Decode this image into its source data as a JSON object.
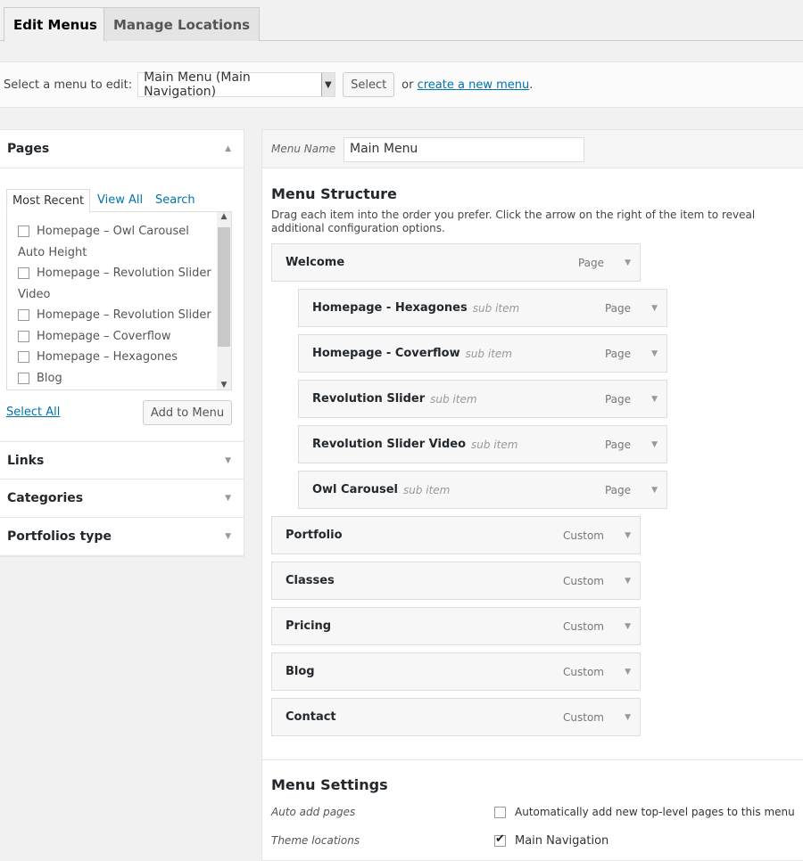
{
  "tabs": [
    {
      "label": "Edit Menus",
      "active": true
    },
    {
      "label": "Manage Locations",
      "active": false
    }
  ],
  "select_bar": {
    "label": "Select a menu to edit:",
    "value": "Main Menu (Main Navigation)",
    "button": "Select",
    "or_text": "or",
    "create_link": "create a new menu",
    "period": "."
  },
  "left": {
    "pages_title": "Pages",
    "tabs": [
      "Most Recent",
      "View All",
      "Search"
    ],
    "items": [
      {
        "label": "Homepage – Owl Carousel",
        "checkbox": true
      },
      {
        "label": "Auto Height",
        "checkbox": false
      },
      {
        "label": "Homepage – Revolution Slider",
        "checkbox": true
      },
      {
        "label": "Video",
        "checkbox": false
      },
      {
        "label": "Homepage – Revolution Slider",
        "checkbox": true
      },
      {
        "label": "Homepage – Coverflow",
        "checkbox": true
      },
      {
        "label": "Homepage – Hexagones",
        "checkbox": true
      },
      {
        "label": "Blog",
        "checkbox": true
      }
    ],
    "select_all": "Select All",
    "add_button": "Add to Menu",
    "sections": [
      "Links",
      "Categories",
      "Portfolios type"
    ]
  },
  "menu": {
    "name_label": "Menu Name",
    "name_value": "Main Menu",
    "structure_title": "Menu Structure",
    "structure_desc": "Drag each item into the order you prefer. Click the arrow on the right of the item to reveal additional configuration options.",
    "items": [
      {
        "title": "Welcome",
        "type": "Page",
        "depth": 0,
        "sub": ""
      },
      {
        "title": "Homepage - Hexagones",
        "type": "Page",
        "depth": 1,
        "sub": "sub item"
      },
      {
        "title": "Homepage - Coverflow",
        "type": "Page",
        "depth": 1,
        "sub": "sub item"
      },
      {
        "title": "Revolution Slider",
        "type": "Page",
        "depth": 1,
        "sub": "sub item"
      },
      {
        "title": "Revolution Slider Video",
        "type": "Page",
        "depth": 1,
        "sub": "sub item"
      },
      {
        "title": "Owl Carousel",
        "type": "Page",
        "depth": 1,
        "sub": "sub item"
      },
      {
        "title": "Portfolio",
        "type": "Custom",
        "depth": 0,
        "sub": ""
      },
      {
        "title": "Classes",
        "type": "Custom",
        "depth": 0,
        "sub": ""
      },
      {
        "title": "Pricing",
        "type": "Custom",
        "depth": 0,
        "sub": ""
      },
      {
        "title": "Blog",
        "type": "Custom",
        "depth": 0,
        "sub": ""
      },
      {
        "title": "Contact",
        "type": "Custom",
        "depth": 0,
        "sub": ""
      }
    ],
    "settings_title": "Menu Settings",
    "auto_add_label": "Auto add pages",
    "auto_add_text": "Automatically add new top-level pages to this menu",
    "auto_add_checked": false,
    "theme_loc_label": "Theme locations",
    "theme_loc_text": "Main Navigation",
    "theme_loc_checked": true
  }
}
